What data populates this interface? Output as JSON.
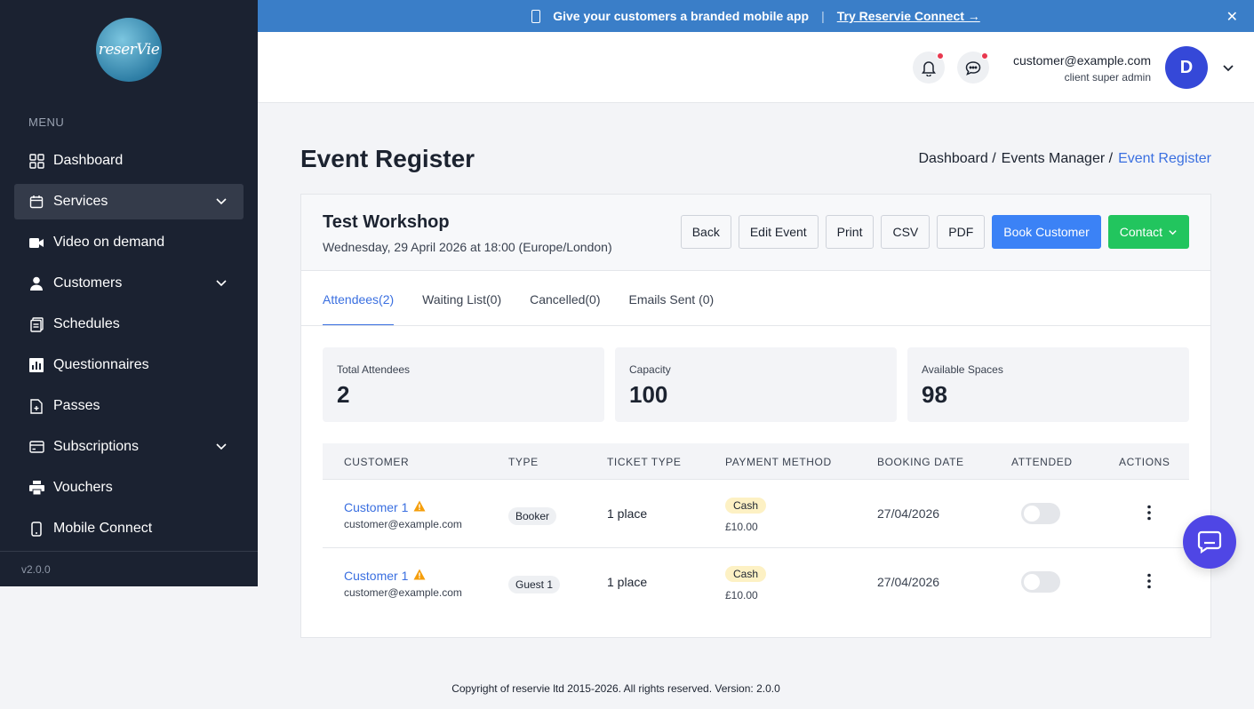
{
  "banner": {
    "text": "Give your customers a branded mobile app",
    "separator": "|",
    "link": "Try Reservie Connect →",
    "close": "✕"
  },
  "sidebar": {
    "logo_text": "reserVie",
    "menu_title": "MENU",
    "items": [
      {
        "label": "Dashboard",
        "icon": "grid-icon"
      },
      {
        "label": "Services",
        "icon": "calendar-icon",
        "active": true,
        "expandable": true
      },
      {
        "label": "Video on demand",
        "icon": "video-icon"
      },
      {
        "label": "Customers",
        "icon": "user-icon",
        "expandable": true
      },
      {
        "label": "Schedules",
        "icon": "clipboard-icon"
      },
      {
        "label": "Questionnaires",
        "icon": "bar-chart-icon"
      },
      {
        "label": "Passes",
        "icon": "document-icon"
      },
      {
        "label": "Subscriptions",
        "icon": "card-icon",
        "expandable": true
      },
      {
        "label": "Vouchers",
        "icon": "printer-icon"
      },
      {
        "label": "Mobile Connect",
        "icon": "phone-icon"
      }
    ],
    "version": "v2.0.0"
  },
  "header": {
    "email": "customer@example.com",
    "role": "client super admin",
    "avatar_initial": "D"
  },
  "page": {
    "title": "Event Register",
    "breadcrumb": [
      "Dashboard /",
      "Events Manager /",
      "Event Register"
    ]
  },
  "event": {
    "name": "Test Workshop",
    "date": "Wednesday, 29 April 2026 at 18:00 (Europe/London)",
    "buttons": {
      "back": "Back",
      "edit": "Edit Event",
      "print": "Print",
      "csv": "CSV",
      "pdf": "PDF",
      "book": "Book Customer",
      "contact": "Contact"
    }
  },
  "tabs": [
    "Attendees(2)",
    "Waiting List(0)",
    "Cancelled(0)",
    "Emails Sent (0)"
  ],
  "stats": [
    {
      "label": "Total Attendees",
      "value": "2"
    },
    {
      "label": "Capacity",
      "value": "100"
    },
    {
      "label": "Available Spaces",
      "value": "98"
    }
  ],
  "table": {
    "headers": [
      "CUSTOMER",
      "TYPE",
      "TICKET TYPE",
      "PAYMENT METHOD",
      "BOOKING DATE",
      "ATTENDED",
      "ACTIONS"
    ],
    "rows": [
      {
        "name": "Customer 1",
        "email": "customer@example.com",
        "type": "Booker",
        "ticket": "1 place",
        "payment": "Cash",
        "amount": "£10.00",
        "date": "27/04/2026",
        "attended": false
      },
      {
        "name": "Customer 1",
        "email": "customer@example.com",
        "type": "Guest 1",
        "ticket": "1 place",
        "payment": "Cash",
        "amount": "£10.00",
        "date": "27/04/2026",
        "attended": false
      }
    ]
  },
  "footer": "Copyright of reservie ltd 2015-2026. All rights reserved. Version: 2.0.0",
  "colors": {
    "sidebar_bg": "#1b2231",
    "banner_bg": "#3a7ec8",
    "primary": "#3b82f6",
    "success": "#22c55e",
    "link": "#3a6fe0",
    "avatar": "#3548d8",
    "chat_fab": "#4f46e5"
  }
}
